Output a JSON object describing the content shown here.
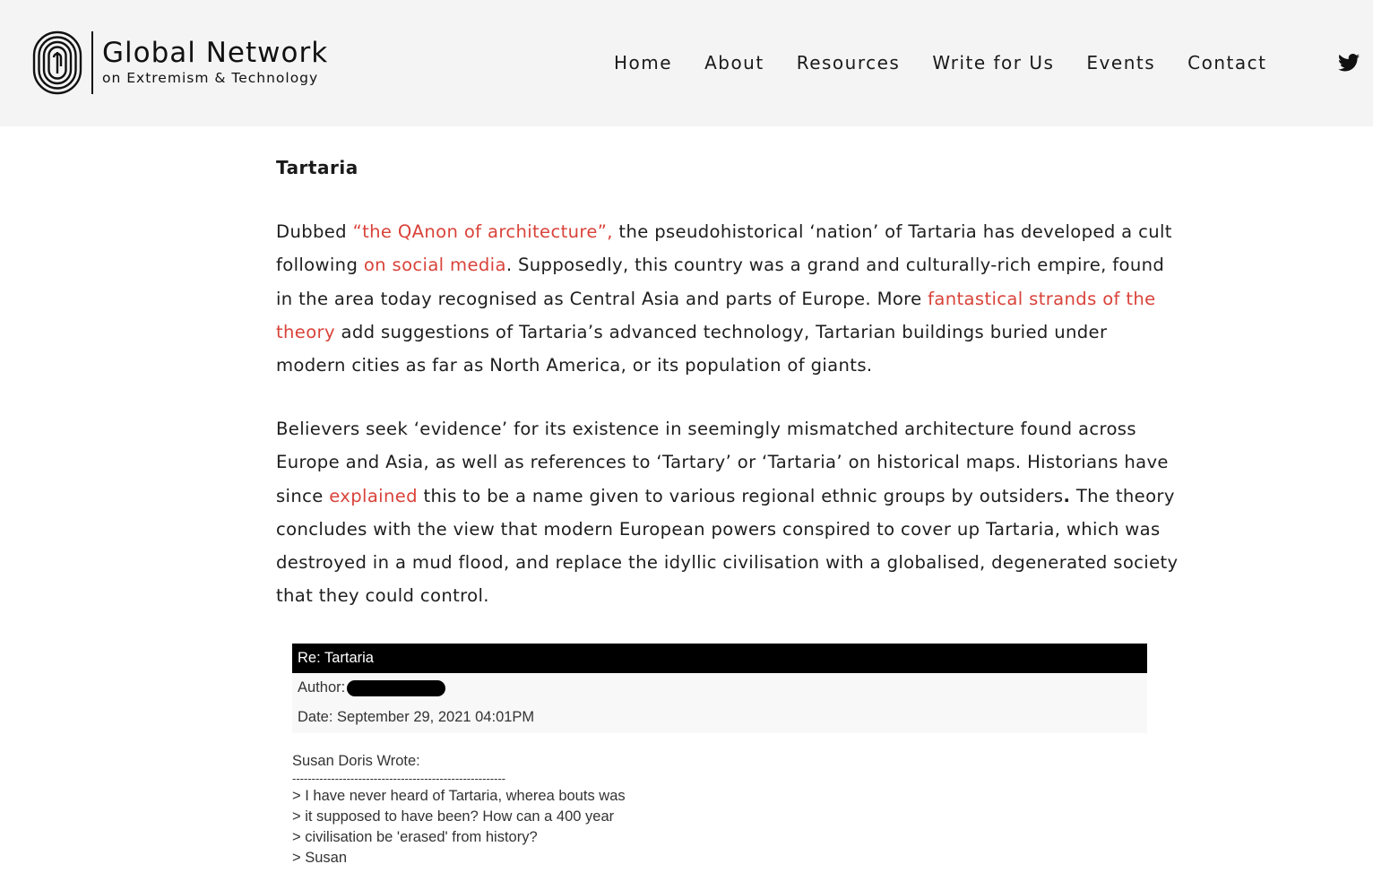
{
  "header": {
    "logo": {
      "title": "Global Network",
      "subtitle": "on Extremism & Technology"
    },
    "nav": [
      "Home",
      "About",
      "Resources",
      "Write for Us",
      "Events",
      "Contact"
    ],
    "social_icon": "twitter-icon"
  },
  "article": {
    "section_title": "Tartaria",
    "p1": {
      "t1": "Dubbed ",
      "l1": "“the QAnon of architecture”,",
      "t2": " the pseudohistorical ‘nation’ of Tartaria has developed a cult following ",
      "l2": "on social media",
      "t3": ". Supposedly, this country was a grand and culturally-rich empire, found in the area today recognised as Central Asia and parts of Europe. More ",
      "l3": "fantastical strands of the theory",
      "t4": " add suggestions of Tartaria’s advanced technology, Tartarian buildings buried under modern cities as far as North America, or its population of giants."
    },
    "p2": {
      "t1": "Believers seek ‘evidence’ for its existence in seemingly mismatched architecture found across Europe and Asia, as well as references to ‘Tartary’ or ‘Tartaria’ on historical maps. Historians have since ",
      "l1": "explained",
      "t2": " this to be a name given to various regional ethnic groups by outsiders",
      "b1": ".",
      "t3": " The theory concludes with the view that modern European powers conspired to cover up Tartaria, which was destroyed in a mud flood, and replace the idyllic civilisation with a globalised, degenerated society that they could control."
    },
    "link_color": "#d9433a"
  },
  "forum_post": {
    "header": "Re: Tartaria",
    "author_label": "Author:",
    "date": "Date: September 29, 2021 04:01PM",
    "quote_lines": [
      "Susan Doris Wrote:",
      "-------------------------------------------------------",
      "> I have never heard of Tartaria, wherea bouts was",
      "> it supposed to have been? How can a 400 year",
      "> civilisation be 'erased' from history?",
      "> Susan"
    ]
  }
}
